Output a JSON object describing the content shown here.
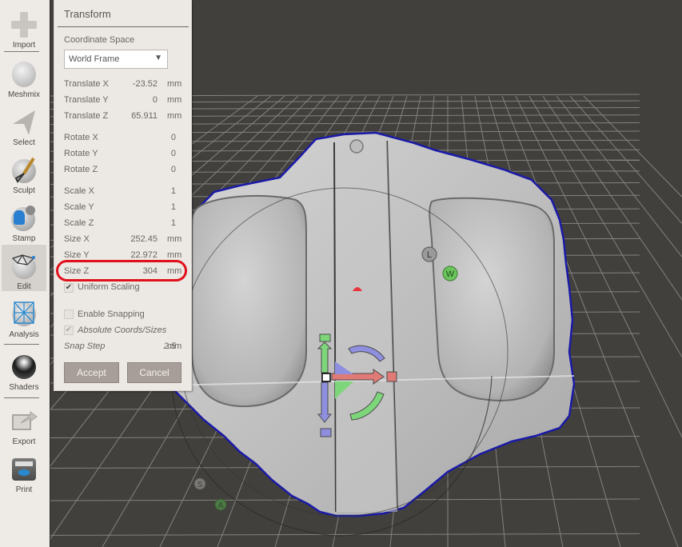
{
  "toolbar": {
    "items": [
      {
        "label": "Import",
        "icon": "plus-icon"
      },
      {
        "label": "Meshmix",
        "icon": "meshmix-head-icon"
      },
      {
        "label": "Select",
        "icon": "select-arrow-icon"
      },
      {
        "label": "Sculpt",
        "icon": "sculpt-brush-icon"
      },
      {
        "label": "Stamp",
        "icon": "stamp-icon"
      },
      {
        "label": "Edit",
        "icon": "edit-mesh-icon",
        "active": true
      },
      {
        "label": "Analysis",
        "icon": "analysis-icon"
      },
      {
        "label": "Shaders",
        "icon": "shader-sphere-icon"
      },
      {
        "label": "Export",
        "icon": "export-icon"
      },
      {
        "label": "Print",
        "icon": "printer-icon"
      }
    ]
  },
  "panel": {
    "title": "Transform",
    "coordinate_space_label": "Coordinate Space",
    "coordinate_space_value": "World Frame",
    "fields": {
      "translate_x": {
        "label": "Translate X",
        "value": "-23.52",
        "unit": "mm"
      },
      "translate_y": {
        "label": "Translate Y",
        "value": "0",
        "unit": "mm"
      },
      "translate_z": {
        "label": "Translate Z",
        "value": "65.911",
        "unit": "mm"
      },
      "rotate_x": {
        "label": "Rotate X",
        "value": "0"
      },
      "rotate_y": {
        "label": "Rotate Y",
        "value": "0"
      },
      "rotate_z": {
        "label": "Rotate Z",
        "value": "0"
      },
      "scale_x": {
        "label": "Scale X",
        "value": "1"
      },
      "scale_y": {
        "label": "Scale Y",
        "value": "1"
      },
      "scale_z": {
        "label": "Scale Z",
        "value": "1"
      },
      "size_x": {
        "label": "Size X",
        "value": "252.45",
        "unit": "mm"
      },
      "size_y": {
        "label": "Size Y",
        "value": "22.972",
        "unit": "mm"
      },
      "size_z": {
        "label": "Size Z",
        "value": "304",
        "unit": "mm"
      }
    },
    "uniform_scaling": {
      "label": "Uniform Scaling",
      "checked": "✔"
    },
    "enable_snapping": {
      "label": "Enable Snapping",
      "checked": ""
    },
    "absolute_coords": {
      "label": "Absolute Coords/Sizes",
      "checked": "✔"
    },
    "snap_step": {
      "label": "Snap Step",
      "value": "2.5",
      "unit": "mm"
    },
    "accept_label": "Accept",
    "cancel_label": "Cancel"
  },
  "viewport": {
    "gizmo_labels": {
      "local": "L",
      "world": "W",
      "s": "S",
      "a": "A"
    },
    "colors": {
      "background": "#42403d",
      "grid": "#9a9894",
      "mesh": "#c4c4c4",
      "selection_outline": "#1a1aa8",
      "axis_x": "#e07a76",
      "axis_y": "#7ed67a",
      "axis_z": "#8f8fe0",
      "pivot_marker": "#e8343a"
    }
  }
}
